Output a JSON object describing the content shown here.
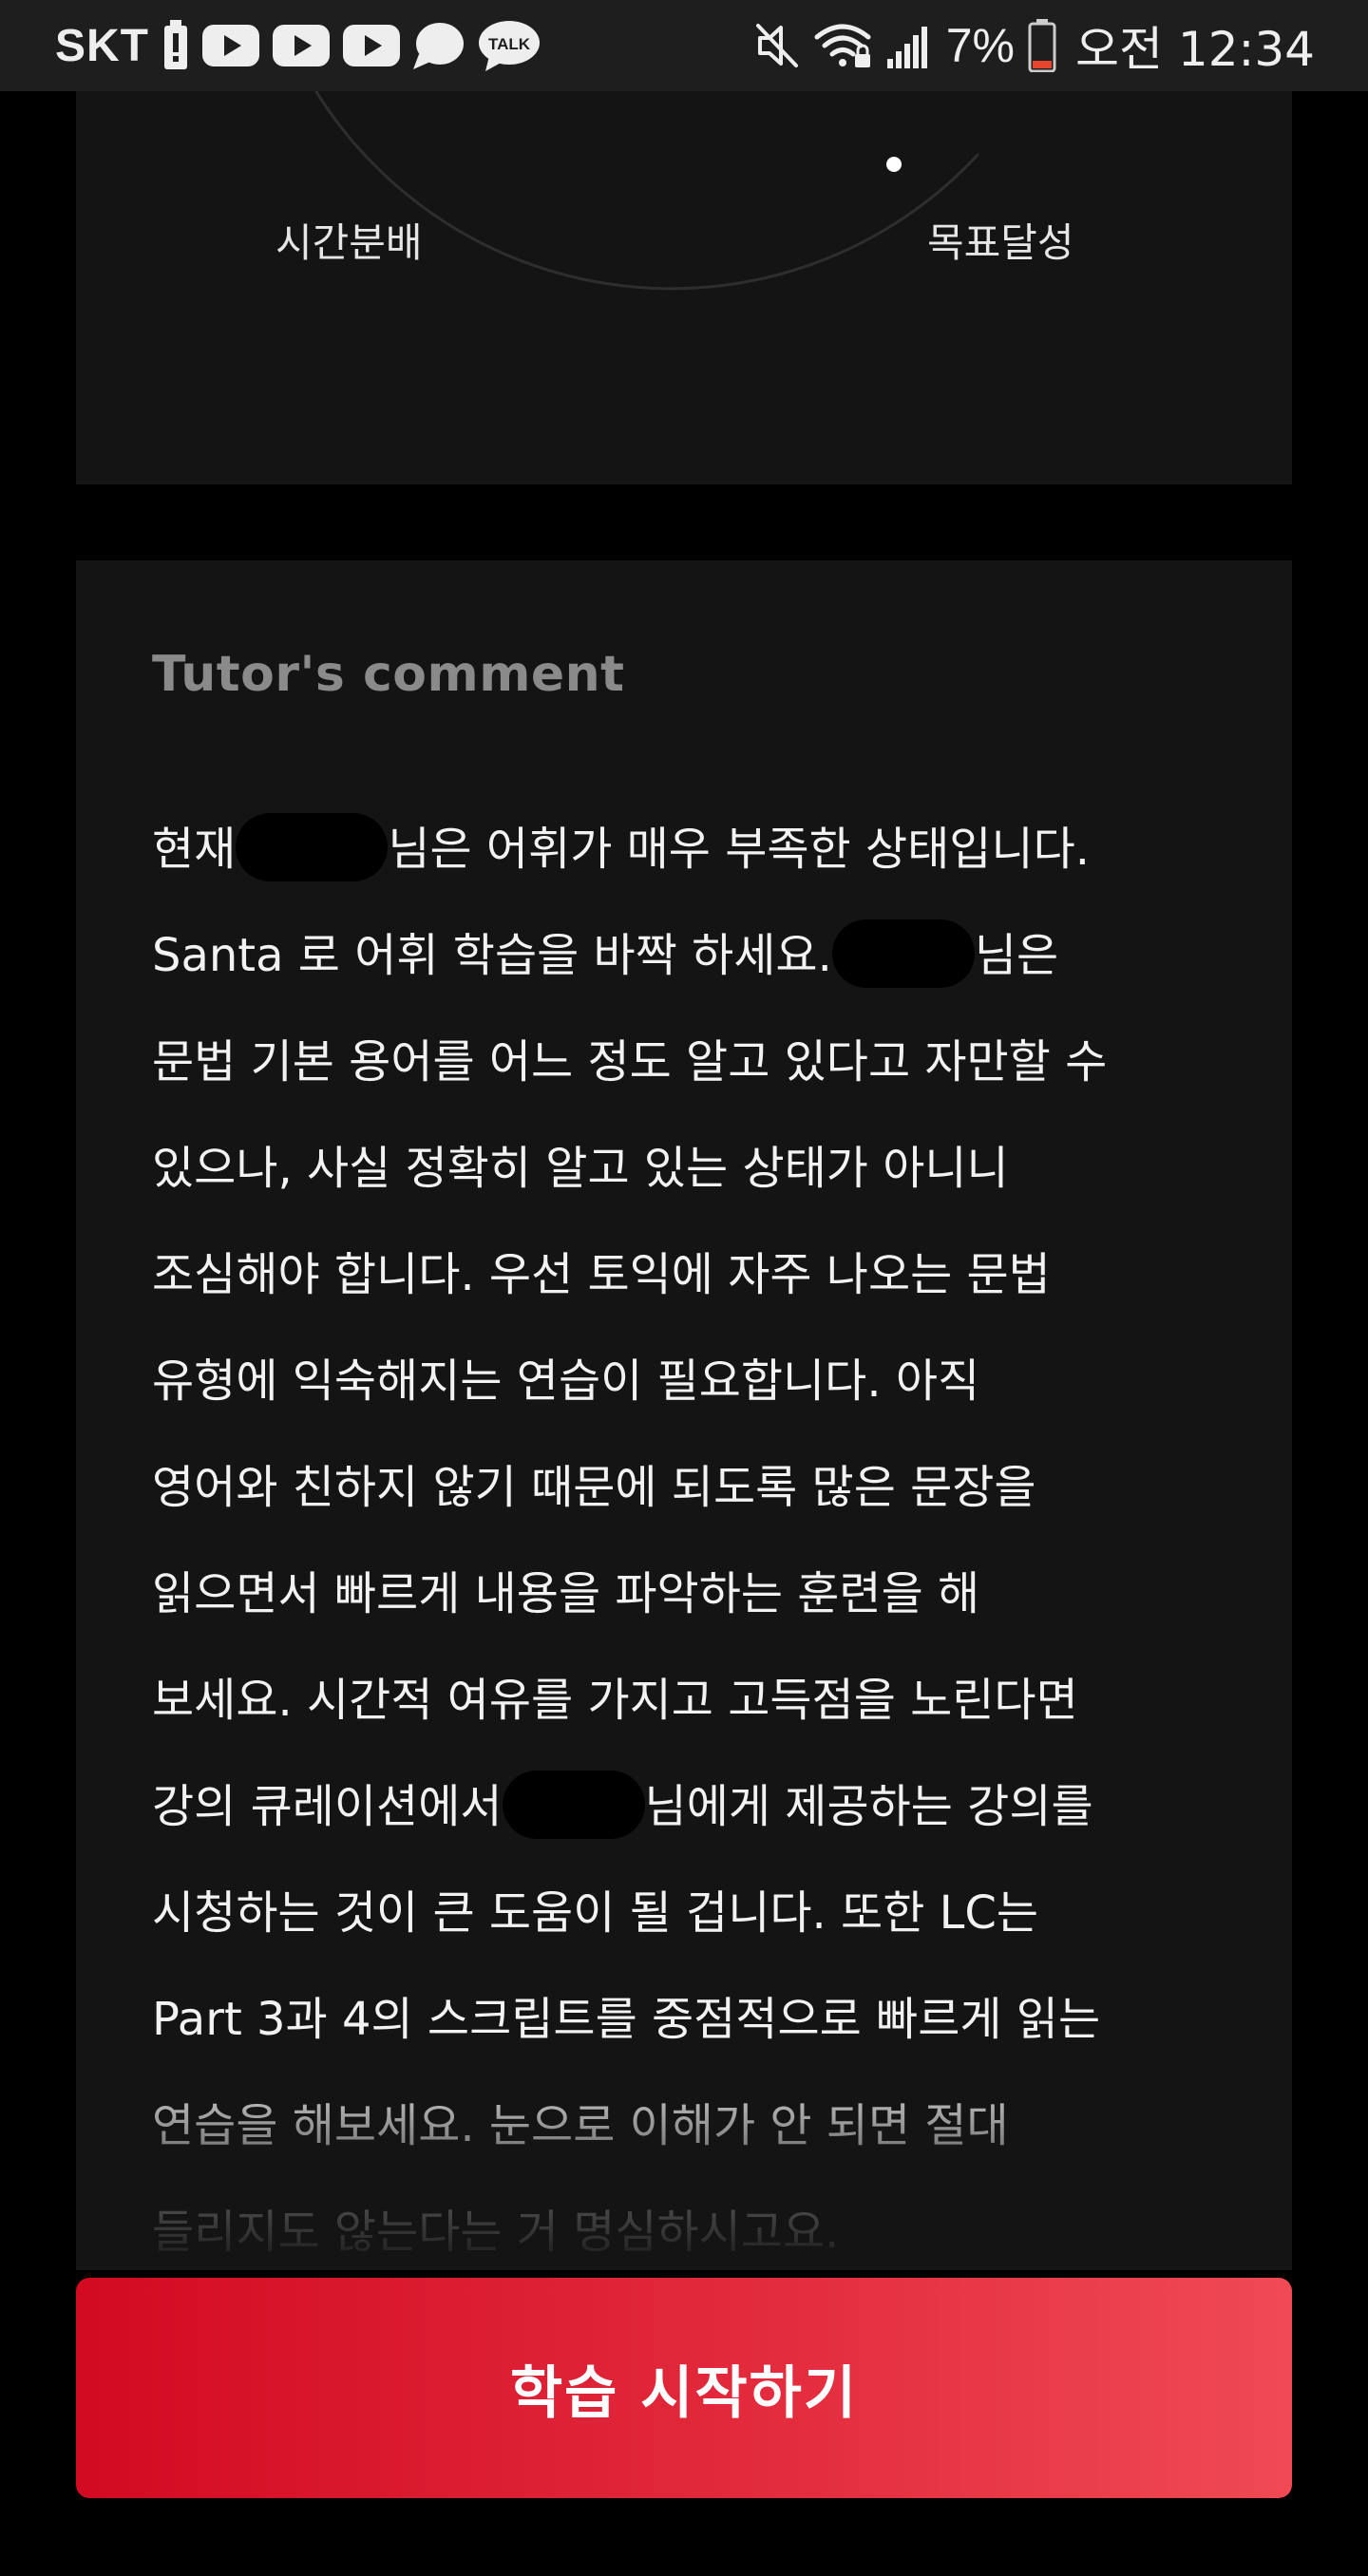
{
  "status_bar": {
    "carrier": "SKT",
    "battery_percent": "7%",
    "time": "오전 12:34",
    "talk_badge": "TALK",
    "left_icons": [
      "battery-alert-icon",
      "youtube-icon",
      "youtube-icon",
      "youtube-icon",
      "chat-bubble-icon",
      "kakaotalk-icon"
    ],
    "right_icons": [
      "mute-icon",
      "wifi-icon",
      "signal-icon",
      "battery-low-icon"
    ]
  },
  "radar_chart": {
    "labels": [
      "시간분배",
      "목표달성"
    ]
  },
  "tutor_comment": {
    "title": "Tutor's comment",
    "lines": [
      [
        "현재",
        "님은 어휘가 매우 부족한 상태입니다."
      ],
      [
        "Santa 로 어휘 학습을 바짝 하세요.",
        "님은"
      ],
      [
        "문법 기본 용어를 어느 정도 알고 있다고 자만할 수"
      ],
      [
        "있으나, 사실 정확히 알고 있는 상태가 아니니"
      ],
      [
        "조심해야 합니다. 우선 토익에 자주 나오는 문법"
      ],
      [
        "유형에 익숙해지는 연습이 필요합니다. 아직"
      ],
      [
        "영어와 친하지 않기 때문에 되도록 많은 문장을"
      ],
      [
        "읽으면서 빠르게 내용을 파악하는 훈련을 해"
      ],
      [
        "보세요. 시간적 여유를 가지고 고득점을 노린다면"
      ],
      [
        "강의 큐레이션에서",
        "님에게 제공하는 강의를"
      ],
      [
        "시청하는 것이 큰 도움이 될 겁니다. 또한 LC는"
      ],
      [
        "Part 3과 4의 스크립트를 중점적으로 빠르게 읽는"
      ],
      [
        "연습을 해보세요. 눈으로 이해가 안 되면 절대"
      ],
      [
        "들리지도 않는다는 거 명심하시고요."
      ]
    ]
  },
  "cta": {
    "label": "학습 시작하기"
  },
  "colors": {
    "background": "#000000",
    "card": "#141414",
    "status_bar": "#1e1e1e",
    "title_gray": "#8a8a8a",
    "cta_start": "#d20a22",
    "cta_end": "#f04a54",
    "battery_low": "#e8452e"
  }
}
